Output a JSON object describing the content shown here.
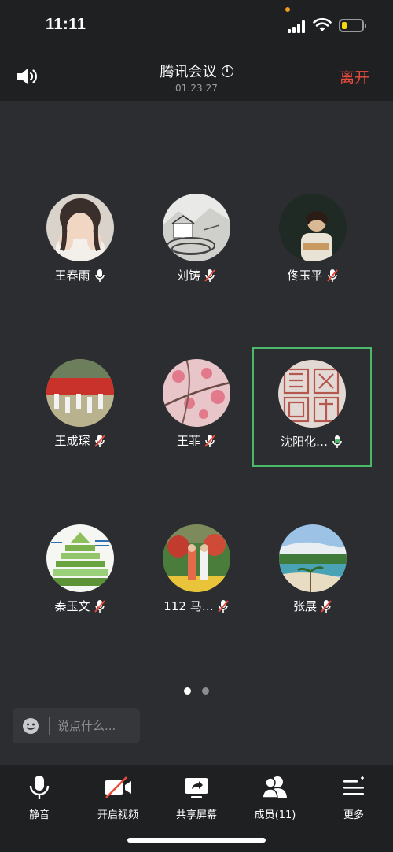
{
  "status_bar": {
    "time": "11:11",
    "battery_level": 0.25
  },
  "header": {
    "title": "腾讯会议",
    "timer": "01:23:27",
    "leave_label": "离开"
  },
  "participants": [
    {
      "name": "王春雨",
      "mic": "on"
    },
    {
      "name": "刘铸",
      "mic": "muted"
    },
    {
      "name": "佟玉平",
      "mic": "muted"
    },
    {
      "name": "王成琛",
      "mic": "muted"
    },
    {
      "name": "王菲",
      "mic": "muted"
    },
    {
      "name": "沈阳化…",
      "mic": "speaking",
      "active": true
    },
    {
      "name": "秦玉文",
      "mic": "muted"
    },
    {
      "name": "112 马…",
      "mic": "muted"
    },
    {
      "name": "张展",
      "mic": "muted"
    }
  ],
  "pagination": {
    "current": 1,
    "total": 2
  },
  "chat": {
    "placeholder": "说点什么..."
  },
  "toolbar": {
    "mute_label": "静音",
    "video_label": "开启视频",
    "share_label": "共享屏幕",
    "members_label": "成员(11)",
    "more_label": "更多"
  },
  "colors": {
    "background": "#2b2d30",
    "bar": "#1f2022",
    "leave": "#e94b3c",
    "active_border": "#4cb86a",
    "muted_slash": "#e94b3c"
  }
}
